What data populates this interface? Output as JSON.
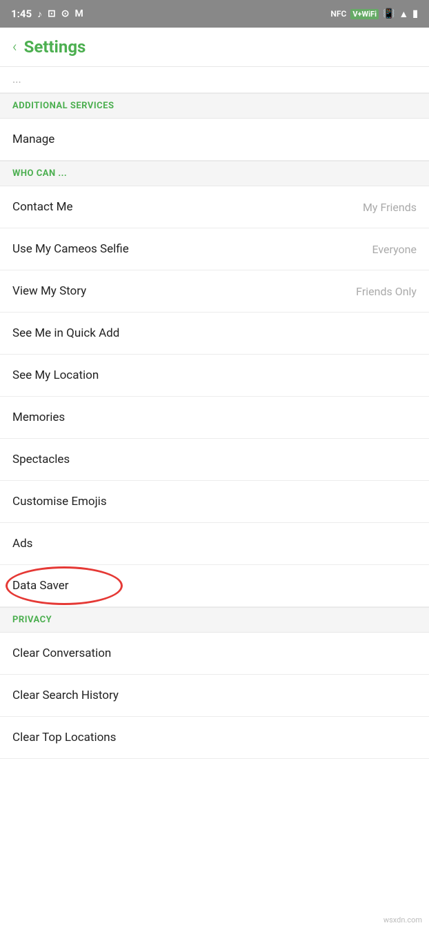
{
  "statusBar": {
    "time": "1:45",
    "icons": [
      "music-note",
      "instagram",
      "instagram2",
      "gmail",
      "nfc",
      "wifi",
      "vibrate",
      "signal",
      "battery"
    ]
  },
  "header": {
    "backLabel": "‹",
    "title": "Settings"
  },
  "croppedText": "...",
  "sections": [
    {
      "id": "additional-services",
      "label": "ADDITIONAL SERVICES",
      "rows": [
        {
          "id": "manage",
          "label": "Manage",
          "value": ""
        }
      ]
    },
    {
      "id": "who-can",
      "label": "WHO CAN ...",
      "rows": [
        {
          "id": "contact-me",
          "label": "Contact Me",
          "value": "My Friends"
        },
        {
          "id": "use-cameos-selfie",
          "label": "Use My Cameos Selfie",
          "value": "Everyone"
        },
        {
          "id": "view-my-story",
          "label": "View My Story",
          "value": "Friends Only"
        },
        {
          "id": "see-me-quick-add",
          "label": "See Me in Quick Add",
          "value": ""
        },
        {
          "id": "see-my-location",
          "label": "See My Location",
          "value": ""
        },
        {
          "id": "memories",
          "label": "Memories",
          "value": ""
        },
        {
          "id": "spectacles",
          "label": "Spectacles",
          "value": ""
        },
        {
          "id": "customise-emojis",
          "label": "Customise Emojis",
          "value": ""
        },
        {
          "id": "ads",
          "label": "Ads",
          "value": ""
        },
        {
          "id": "data-saver",
          "label": "Data Saver",
          "value": ""
        }
      ]
    },
    {
      "id": "privacy",
      "label": "PRIVACY",
      "rows": [
        {
          "id": "clear-conversation",
          "label": "Clear Conversation",
          "value": ""
        },
        {
          "id": "clear-search-history",
          "label": "Clear Search History",
          "value": ""
        },
        {
          "id": "clear-top-locations",
          "label": "Clear Top Locations",
          "value": ""
        }
      ]
    }
  ],
  "watermark": "wsxdn.com"
}
